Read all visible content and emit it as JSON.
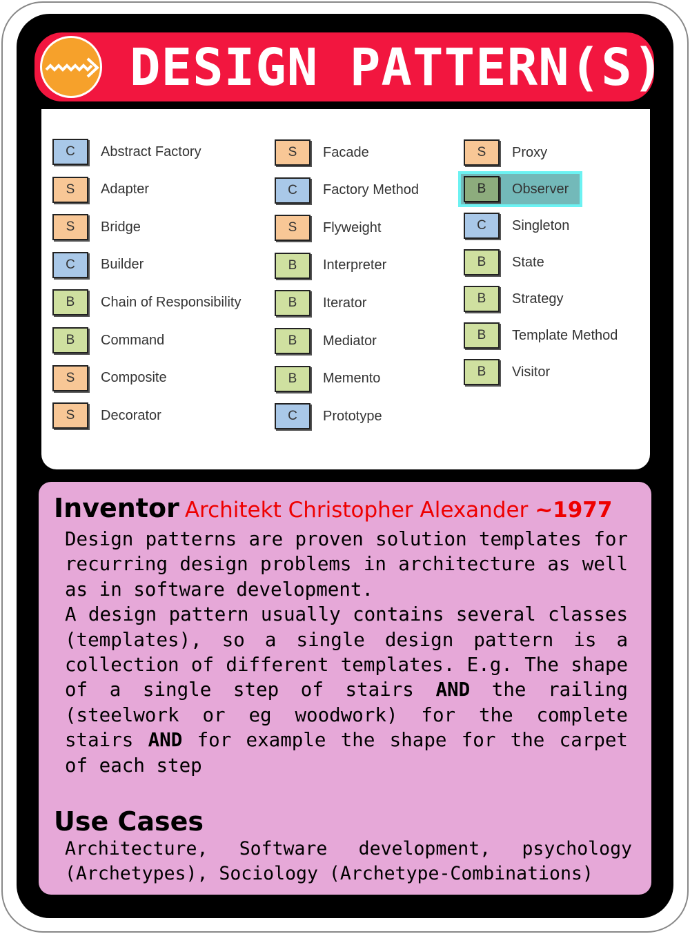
{
  "header": {
    "title": "DESIGN PATTERN(S)",
    "badge_icon": "zigzag-arrow-icon",
    "colors": {
      "banner": "#f2163f",
      "badge": "#f6a12b"
    }
  },
  "patterns": {
    "columns": [
      [
        {
          "code": "C",
          "name": "Abstract Factory"
        },
        {
          "code": "S",
          "name": "Adapter"
        },
        {
          "code": "S",
          "name": "Bridge"
        },
        {
          "code": "C",
          "name": "Builder"
        },
        {
          "code": "B",
          "name": "Chain of Responsibility"
        },
        {
          "code": "B",
          "name": "Command"
        },
        {
          "code": "S",
          "name": "Composite"
        },
        {
          "code": "S",
          "name": "Decorator"
        }
      ],
      [
        {
          "code": "S",
          "name": "Facade"
        },
        {
          "code": "C",
          "name": "Factory Method"
        },
        {
          "code": "S",
          "name": "Flyweight"
        },
        {
          "code": "B",
          "name": "Interpreter"
        },
        {
          "code": "B",
          "name": "Iterator"
        },
        {
          "code": "B",
          "name": "Mediator"
        },
        {
          "code": "B",
          "name": "Memento"
        },
        {
          "code": "C",
          "name": "Prototype"
        }
      ],
      [
        {
          "code": "S",
          "name": "Proxy"
        },
        {
          "code": "B",
          "name": "Observer",
          "highlighted": true
        },
        {
          "code": "C",
          "name": "Singleton"
        },
        {
          "code": "B",
          "name": "State"
        },
        {
          "code": "B",
          "name": "Strategy"
        },
        {
          "code": "B",
          "name": "Template Method"
        },
        {
          "code": "B",
          "name": "Visitor"
        }
      ]
    ],
    "colors": {
      "C": "#a9c8e8",
      "S": "#f8c796",
      "B": "#cfe0a0",
      "highlight": "#6cf2f2"
    }
  },
  "inventor": {
    "label": "Inventor",
    "name": "Architekt Christopher Alexander ",
    "year": "~1977",
    "description": [
      "Design patterns are proven solution templates for recurring design problems in architecture as well as in software development.",
      "A design pattern usually contains several classes (templates), so a single design pattern is a collection of different templates. E.g. The shape of a single step of stairs ",
      "AND",
      " the railing (steelwork or eg woodwork) for the complete stairs ",
      "AND",
      " for example the shape for the carpet of each step"
    ]
  },
  "use_cases": {
    "label": "Use Cases",
    "text": "Architecture, Software development, psychology (Archetypes), Sociology (Archetype-Combinations)"
  }
}
